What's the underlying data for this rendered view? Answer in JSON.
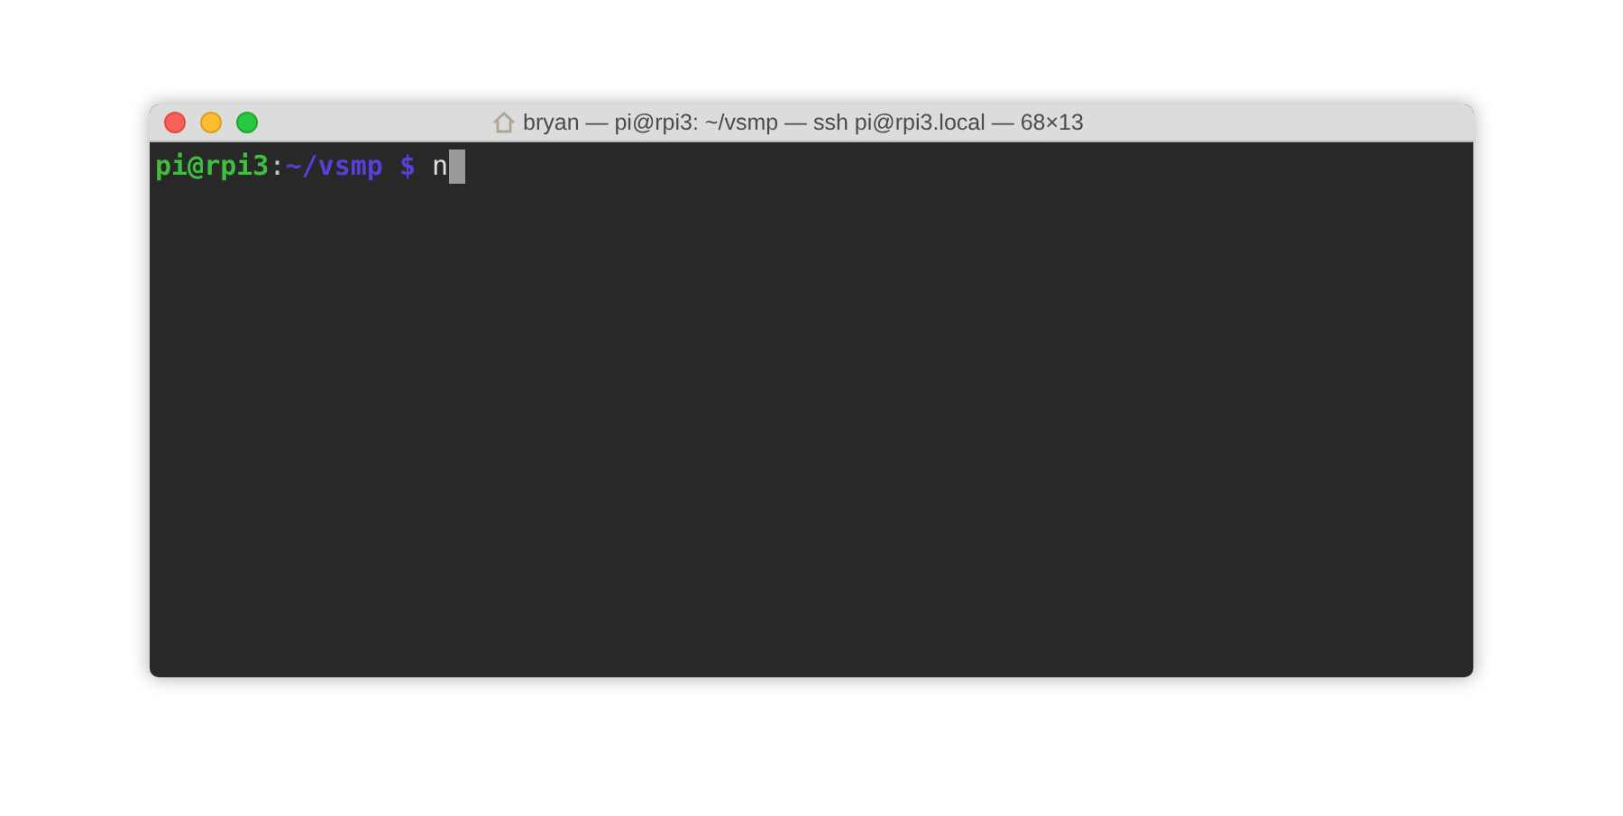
{
  "window": {
    "title": "bryan — pi@rpi3: ~/vsmp — ssh pi@rpi3.local — 68×13"
  },
  "terminal": {
    "lines": [
      {
        "user_host": "pi@rpi3",
        "separator": ":",
        "path": "~/vsmp",
        "symbol": "$",
        "input": "n",
        "cursor": true
      }
    ]
  }
}
